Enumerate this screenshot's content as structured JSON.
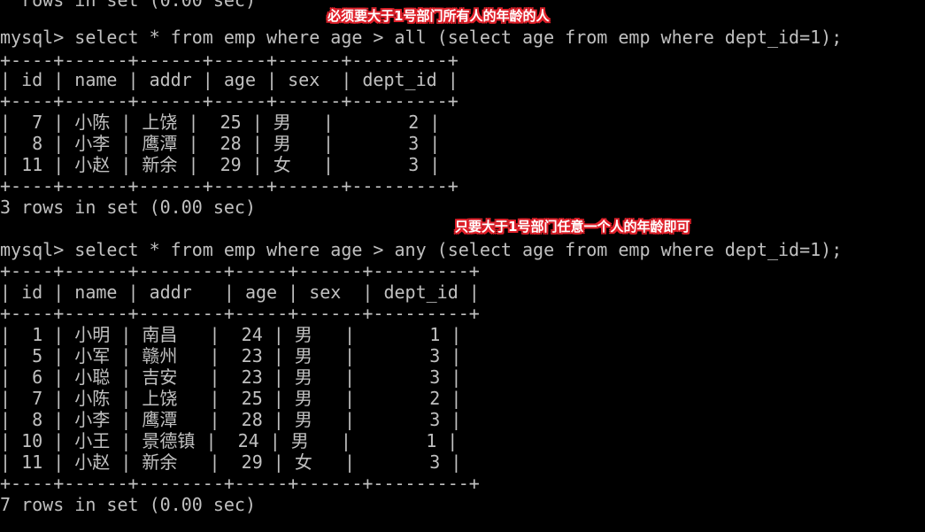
{
  "colors": {
    "background": "#000000",
    "text": "#c0c0c0",
    "annotation_text": "#ffffff",
    "annotation_outline": "#e0202a"
  },
  "top_partial": "  rows in set (0.00 sec)",
  "annotation_all": "必须要大于1号部门所有人的年龄的人",
  "annotation_any": "只要大于1号部门任意一个人的年龄即可",
  "query1": {
    "prompt": "mysql> select * from emp where age > all (select age from emp where dept_id=1);",
    "border": "+----+------+------+-----+------+---------+",
    "header": "| id | name | addr | age | sex  | dept_id |",
    "rows": [
      "|  7 | 小陈 | 上饶 |  25 | 男   |       2 |",
      "|  8 | 小李 | 鹰潭 |  28 | 男   |       3 |",
      "| 11 | 小赵 | 新余 |  29 | 女   |       3 |"
    ],
    "footer": "3 rows in set (0.00 sec)"
  },
  "query2": {
    "prompt": "mysql> select * from emp where age > any (select age from emp where dept_id=1);",
    "border": "+----+------+--------+-----+------+---------+",
    "header": "| id | name | addr   | age | sex  | dept_id |",
    "rows": [
      "|  1 | 小明 | 南昌   |  24 | 男   |       1 |",
      "|  5 | 小军 | 赣州   |  23 | 男   |       3 |",
      "|  6 | 小聪 | 吉安   |  23 | 男   |       3 |",
      "|  7 | 小陈 | 上饶   |  25 | 男   |       2 |",
      "|  8 | 小李 | 鹰潭   |  28 | 男   |       3 |",
      "| 10 | 小王 | 景德镇 |  24 | 男   |       1 |",
      "| 11 | 小赵 | 新余   |  29 | 女   |       3 |"
    ],
    "footer": "7 rows in set (0.00 sec)"
  }
}
